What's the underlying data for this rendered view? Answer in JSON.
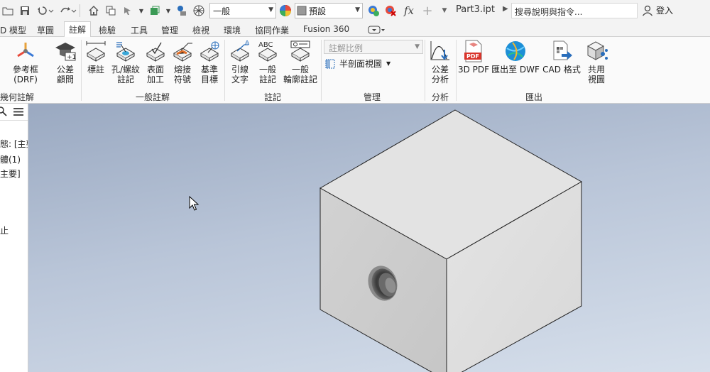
{
  "title_bar": {
    "style_combo": "一般",
    "appearance_combo": "預設",
    "fx_label": "fx",
    "document": "Part3.ipt",
    "search_placeholder": "搜尋說明與指令...",
    "login": "登入"
  },
  "tabs": [
    {
      "label": "D 模型"
    },
    {
      "label": "草圖"
    },
    {
      "label": "註解",
      "active": true
    },
    {
      "label": "檢驗"
    },
    {
      "label": "工具"
    },
    {
      "label": "管理"
    },
    {
      "label": "檢視"
    },
    {
      "label": "環境"
    },
    {
      "label": "協同作業"
    },
    {
      "label": "Fusion 360"
    }
  ],
  "ribbon": {
    "buttons": [
      {
        "line1": "參考框 (DRF)",
        "line2": ""
      },
      {
        "line1": "公差",
        "line2": "顧問"
      },
      {
        "line1": "標註",
        "line2": ""
      },
      {
        "line1": "孔/螺紋",
        "line2": "註記"
      },
      {
        "line1": "表面",
        "line2": "加工"
      },
      {
        "line1": "熔接",
        "line2": "符號"
      },
      {
        "line1": "基準",
        "line2": "目標"
      },
      {
        "line1": "引線",
        "line2": "文字"
      },
      {
        "line1": "一般",
        "line2": "註記"
      },
      {
        "line1": "一般",
        "line2": "輪廓註記"
      },
      {
        "line1": "公差",
        "line2": "分析"
      },
      {
        "line1": "3D PDF",
        "line2": ""
      },
      {
        "line1": "匯出至 DWF",
        "line2": ""
      },
      {
        "line1": "CAD 格式",
        "line2": ""
      },
      {
        "line1": "共用",
        "line2": "視圖"
      }
    ],
    "panels": {
      "geometric": "幾何註解",
      "general": "一般註解",
      "notes": "註記",
      "manage": "管理",
      "analysis": "分析",
      "export": "匯出"
    },
    "scale_placeholder": "註解比例",
    "half_section_label": "半剖面視圖",
    "abc_text": "ABC",
    "pdf_badge": "PDF"
  },
  "browser": {
    "items": [
      "態: [主要",
      "體(1)",
      "主要]",
      "止"
    ]
  },
  "colors": {
    "accent_blue": "#2a6ebb",
    "active_tab_bg": "#ffffff",
    "viewport_top": "#9aa9c1",
    "viewport_bottom": "#d6dfeb"
  }
}
